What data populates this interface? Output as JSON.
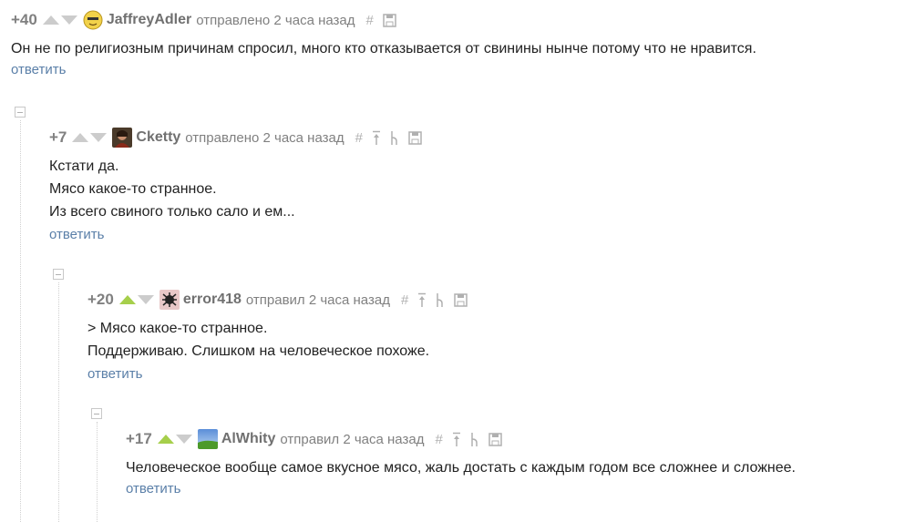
{
  "comments": [
    {
      "rating": "+40",
      "username": "JaffreyAdler",
      "time": "отправлено 2 часа назад",
      "hash": "#",
      "lines": [
        "Он не по религиозным причинам спросил, много кто отказывается от свинины нынче потому что не нравится."
      ],
      "reply": "ответить"
    },
    {
      "rating": "+7",
      "username": "Cketty",
      "time": "отправлено 2 часа назад",
      "hash": "#",
      "lines": [
        "Кстати да.",
        "Мясо какое-то странное.",
        "Из всего свиного только сало и ем..."
      ],
      "reply": "ответить"
    },
    {
      "rating": "+20",
      "username": "error418",
      "time": "отправил 2 часа назад",
      "hash": "#",
      "lines": [
        "> Мясо какое-то странное.",
        "Поддерживаю. Слишком на человеческое похоже."
      ],
      "reply": "ответить"
    },
    {
      "rating": "+17",
      "username": "AlWhity",
      "time": "отправил 2 часа назад",
      "hash": "#",
      "lines": [
        "Человеческое вообще самое вкусное мясо, жаль достать с каждым годом все сложнее и сложнее."
      ],
      "reply": "ответить"
    }
  ],
  "colors": {
    "vote_active": "#a6cf4b",
    "vote_inactive": "#cccccc",
    "reply_link": "#5a7fa8"
  },
  "icons": [
    "arrow-up-icon",
    "arrow-down-icon",
    "hash-icon",
    "parent-up-icon",
    "branch-icon",
    "save-icon",
    "collapse-icon"
  ]
}
